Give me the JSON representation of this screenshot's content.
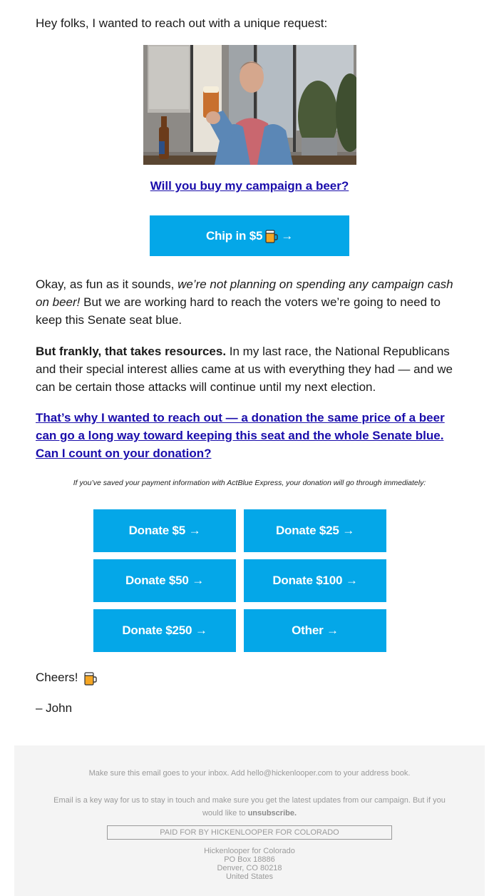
{
  "intro": "Hey folks, I wanted to reach out with a unique request:",
  "hero_image": {
    "alt": "Man in denim jacket raising a glass of beer on a porch",
    "icon": "video-still-image"
  },
  "beer_link": "Will you buy my campaign a beer?",
  "chip_button": {
    "label": "Chip in $5",
    "emoji": "beer-mug-icon",
    "arrow": "→"
  },
  "para1": {
    "start": "Okay, as fun as it sounds, ",
    "italic": "we’re not planning on spending any campaign cash on beer!",
    "end": " But we are working hard to reach the voters we’re going to need to keep this Senate seat blue."
  },
  "para2": {
    "bold": "But frankly, that takes resources.",
    "end": " In my last race, the National Republicans and their special interest allies came at us with everything they had — and we can be certain those attacks will continue until my next election."
  },
  "para3_link": "That’s why I wanted to reach out — a donation the same price of a beer can go a long way toward keeping this seat and the whole Senate blue. Can I count on your donation?",
  "express_note": "If you’ve saved your payment information with ActBlue Express, your donation will go through immediately:",
  "donate_buttons": [
    {
      "label": "Donate $5 →"
    },
    {
      "label": "Donate $25 →"
    },
    {
      "label": "Donate $50 →"
    },
    {
      "label": "Donate $100 →"
    },
    {
      "label": "Donate $250 →"
    },
    {
      "label": "Other →"
    }
  ],
  "cheers": "Cheers!",
  "signoff": "– John",
  "footer": {
    "inbox_note": "Make sure this email goes to your inbox. Add hello@hickenlooper.com to your address book.",
    "email_note": "Email is a key way for us to stay in touch and make sure you get the latest updates from our campaign. But if you would like to ",
    "unsubscribe": "unsubscribe.",
    "paid_for": "PAID FOR BY HICKENLOOPER FOR COLORADO",
    "address": [
      "Hickenlooper for Colorado",
      "PO Box 18886",
      "Denver, CO 80218",
      "United States"
    ]
  },
  "colors": {
    "button": "#04a7e8",
    "link": "#1a0dab",
    "footer_bg": "#f4f4f4",
    "footer_text": "#9a9a9a"
  }
}
